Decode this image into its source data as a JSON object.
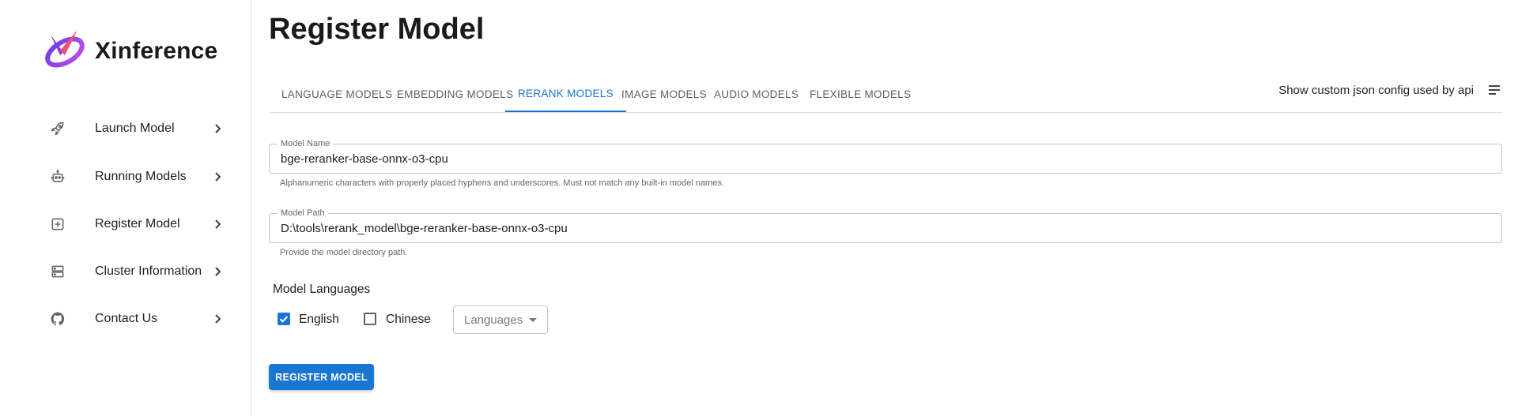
{
  "brand": {
    "name": "Xinference"
  },
  "sidebar": {
    "items": [
      {
        "label": "Launch Model",
        "icon": "rocket-icon"
      },
      {
        "label": "Running Models",
        "icon": "robot-icon"
      },
      {
        "label": "Register Model",
        "icon": "add-box-icon"
      },
      {
        "label": "Cluster Information",
        "icon": "server-icon"
      },
      {
        "label": "Contact Us",
        "icon": "github-icon"
      }
    ]
  },
  "page": {
    "title": "Register Model"
  },
  "tabs": [
    {
      "label": "LANGUAGE MODELS",
      "active": false
    },
    {
      "label": "EMBEDDING MODELS",
      "active": false
    },
    {
      "label": "RERANK MODELS",
      "active": true
    },
    {
      "label": "IMAGE MODELS",
      "active": false
    },
    {
      "label": "AUDIO MODELS",
      "active": false
    },
    {
      "label": "FLEXIBLE MODELS",
      "active": false
    }
  ],
  "json_toggle": {
    "label": "Show custom json config used by api"
  },
  "form": {
    "model_name": {
      "label": "Model Name",
      "value": "bge-reranker-base-onnx-o3-cpu",
      "helper": "Alphanumeric characters with properly placed hyphens and underscores. Must not match any built-in model names."
    },
    "model_path": {
      "label": "Model Path",
      "value": "D:\\tools\\rerank_model\\bge-reranker-base-onnx-o3-cpu",
      "helper": "Provide the model directory path."
    },
    "languages": {
      "label": "Model Languages",
      "options": [
        {
          "label": "English",
          "checked": true
        },
        {
          "label": "Chinese",
          "checked": false
        }
      ],
      "select_placeholder": "Languages"
    },
    "submit_label": "REGISTER MODEL"
  },
  "colors": {
    "accent": "#1976d2",
    "border": "#c4c4c4",
    "text": "#212121"
  }
}
